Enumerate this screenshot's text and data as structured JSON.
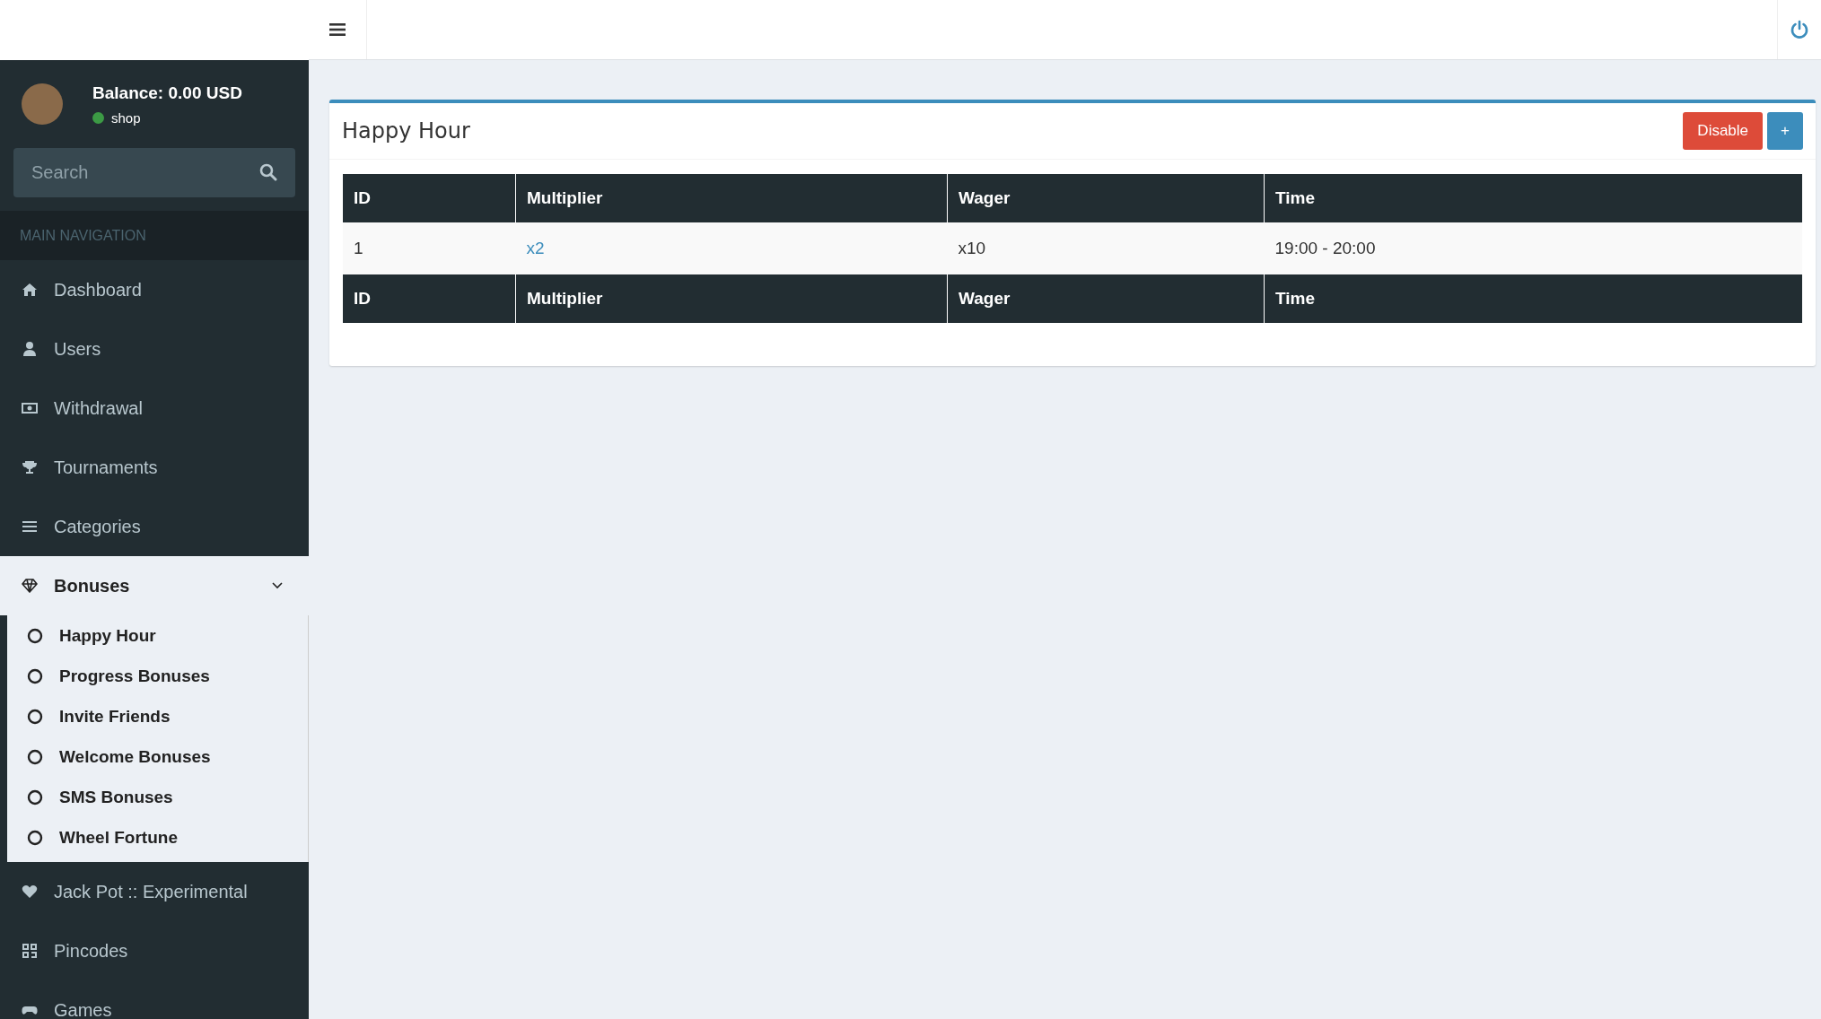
{
  "user": {
    "balance": "Balance: 0.00 USD",
    "status": "shop",
    "online": true
  },
  "search": {
    "placeholder": "Search"
  },
  "nav_header": "MAIN NAVIGATION",
  "nav_items": [
    {
      "label": "Dashboard"
    },
    {
      "label": "Users"
    },
    {
      "label": "Withdrawal"
    },
    {
      "label": "Tournaments"
    },
    {
      "label": "Categories"
    },
    {
      "label": "Bonuses",
      "expanded": true,
      "children": [
        {
          "label": "Happy Hour"
        },
        {
          "label": "Progress Bonuses"
        },
        {
          "label": "Invite Friends"
        },
        {
          "label": "Welcome Bonuses"
        },
        {
          "label": "SMS Bonuses"
        },
        {
          "label": "Wheel Fortune"
        }
      ]
    },
    {
      "label": "Jack Pot :: Experimental"
    },
    {
      "label": "Pincodes"
    },
    {
      "label": "Games"
    }
  ],
  "panel": {
    "title": "Happy Hour",
    "buttons": [
      {
        "label": "Disable",
        "kind": "danger"
      },
      {
        "label": "+",
        "kind": "primary"
      }
    ],
    "table": {
      "columns": [
        "ID",
        "Multiplier",
        "Wager",
        "Time"
      ],
      "rows": [
        [
          "1",
          "x2",
          "x10",
          "19:00 - 20:00"
        ]
      ],
      "footer": [
        "ID",
        "Multiplier",
        "Wager",
        "Time"
      ]
    }
  }
}
